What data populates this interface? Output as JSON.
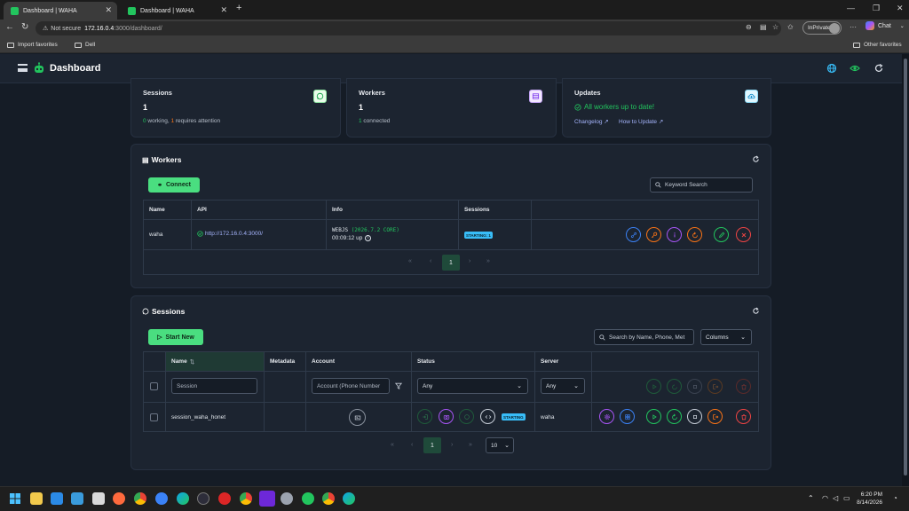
{
  "browser": {
    "tabs": [
      {
        "title": "Dashboard | WAHA",
        "active": true
      },
      {
        "title": "Dashboard | WAHA",
        "active": false
      }
    ],
    "security": "Not secure",
    "url_host": "172.16.0.4",
    "url_path": ":3000/dashboard/",
    "inprivate": "InPrivate",
    "chat": "Chat",
    "favorites": [
      {
        "label": "Import favorites"
      },
      {
        "label": "Dell"
      }
    ],
    "other_favorites": "Other favorites"
  },
  "app": {
    "title": "Dashboard"
  },
  "stats": {
    "sessions": {
      "title": "Sessions",
      "value": "1",
      "working_count": "0",
      "working_text": " working, ",
      "attention_count": "1",
      "attention_text": " requires attention"
    },
    "workers": {
      "title": "Workers",
      "value": "1",
      "connected_count": "1",
      "connected_text": " connected"
    },
    "updates": {
      "title": "Updates",
      "status": "All workers up to date!",
      "changelog": "Changelog",
      "how_to_update": "How to Update"
    }
  },
  "workers_section": {
    "title": "Workers",
    "connect_label": "Connect",
    "search_placeholder": "Keyword Search",
    "columns": [
      "Name",
      "API",
      "Info",
      "Sessions"
    ],
    "rows": [
      {
        "name": "waha",
        "api": "http://172.16.0.4:3000/",
        "engine": "WEBJS",
        "version": "(2026.7.2 CORE)",
        "uptime": "00:09:12 up",
        "sessions_badge": "STARTING: 1"
      }
    ],
    "pagination": {
      "first": "«",
      "prev": "‹",
      "current": "1",
      "next": "›",
      "last": "»"
    }
  },
  "sessions_section": {
    "title": "Sessions",
    "start_new_label": "Start New",
    "search_placeholder": "Search by Name, Phone, Met",
    "columns_label": "Columns",
    "columns": [
      "Name",
      "Metadata",
      "Account",
      "Status",
      "Server"
    ],
    "sort_icon": "⇅",
    "filters": {
      "name_placeholder": "Session",
      "account_placeholder": "Account (Phone Number",
      "status_value": "Any",
      "server_value": "Any"
    },
    "rows": [
      {
        "name": "session_waha_honet",
        "status_badge": "STARTING",
        "server": "waha"
      }
    ],
    "pagination": {
      "first": "«",
      "prev": "‹",
      "current": "1",
      "next": "›",
      "last": "»",
      "page_size": "10"
    }
  },
  "taskbar": {
    "time": "6:20 PM",
    "date": "8/14/2026"
  },
  "colors": {
    "accent_green": "#4ade80",
    "badge_blue": "#38bdf8",
    "attention_orange": "#f97316"
  }
}
